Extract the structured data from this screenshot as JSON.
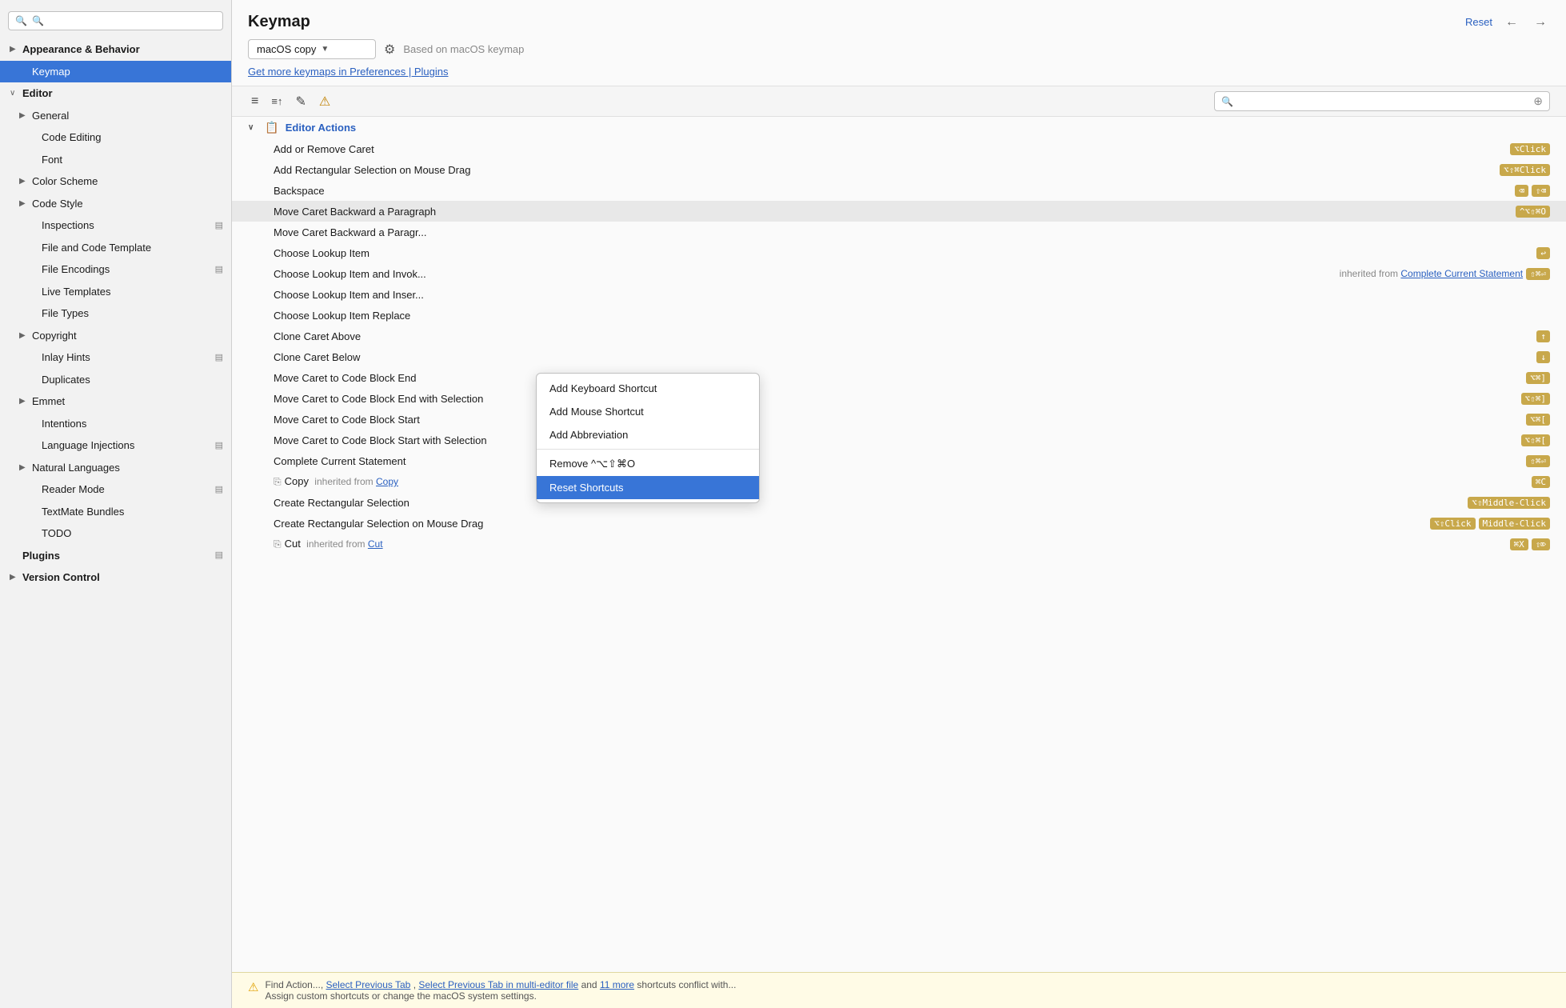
{
  "sidebar": {
    "search_placeholder": "🔍",
    "items": [
      {
        "id": "appearance-behavior",
        "label": "Appearance & Behavior",
        "indent": 0,
        "arrow": "▶",
        "bold": true
      },
      {
        "id": "keymap",
        "label": "Keymap",
        "indent": 1,
        "selected": true
      },
      {
        "id": "editor",
        "label": "Editor",
        "indent": 0,
        "arrow": "∨",
        "bold": true
      },
      {
        "id": "general",
        "label": "General",
        "indent": 1,
        "arrow": "▶"
      },
      {
        "id": "code-editing",
        "label": "Code Editing",
        "indent": 2
      },
      {
        "id": "font",
        "label": "Font",
        "indent": 2
      },
      {
        "id": "color-scheme",
        "label": "Color Scheme",
        "indent": 1,
        "arrow": "▶"
      },
      {
        "id": "code-style",
        "label": "Code Style",
        "indent": 1,
        "arrow": "▶"
      },
      {
        "id": "inspections",
        "label": "Inspections",
        "indent": 2,
        "has_icon": true
      },
      {
        "id": "file-and-code-template",
        "label": "File and Code Template",
        "indent": 2
      },
      {
        "id": "file-encodings",
        "label": "File Encodings",
        "indent": 2,
        "has_icon": true
      },
      {
        "id": "live-templates",
        "label": "Live Templates",
        "indent": 2
      },
      {
        "id": "file-types",
        "label": "File Types",
        "indent": 2
      },
      {
        "id": "copyright",
        "label": "Copyright",
        "indent": 1,
        "arrow": "▶"
      },
      {
        "id": "inlay-hints",
        "label": "Inlay Hints",
        "indent": 2,
        "has_icon": true
      },
      {
        "id": "duplicates",
        "label": "Duplicates",
        "indent": 2
      },
      {
        "id": "emmet",
        "label": "Emmet",
        "indent": 1,
        "arrow": "▶"
      },
      {
        "id": "intentions",
        "label": "Intentions",
        "indent": 2
      },
      {
        "id": "language-injections",
        "label": "Language Injections",
        "indent": 2,
        "has_icon": true
      },
      {
        "id": "natural-languages",
        "label": "Natural Languages",
        "indent": 1,
        "arrow": "▶"
      },
      {
        "id": "reader-mode",
        "label": "Reader Mode",
        "indent": 2,
        "has_icon": true
      },
      {
        "id": "textmate-bundles",
        "label": "TextMate Bundles",
        "indent": 2
      },
      {
        "id": "todo",
        "label": "TODO",
        "indent": 2
      },
      {
        "id": "plugins",
        "label": "Plugins",
        "indent": 0,
        "bold": true,
        "has_icon": true
      },
      {
        "id": "version-control",
        "label": "Version Control",
        "indent": 0,
        "arrow": "▶",
        "bold": true
      }
    ]
  },
  "header": {
    "title": "Keymap",
    "reset_label": "Reset",
    "nav_back_disabled": false,
    "nav_forward_disabled": false
  },
  "keymap_selector": {
    "value": "macOS copy",
    "based_on": "Based on macOS keymap"
  },
  "link_row": {
    "text": "Get more keymaps in Preferences | Plugins"
  },
  "toolbar": {
    "search_placeholder": "🔍",
    "btn1": "≡",
    "btn2": "≡↑",
    "btn3": "✎",
    "btn4": "⚠"
  },
  "actions": {
    "group_label": "Editor Actions",
    "rows": [
      {
        "name": "Add or Remove Caret",
        "shortcuts": [
          {
            "label": "⌥Click",
            "color": "gold"
          }
        ]
      },
      {
        "name": "Add Rectangular Selection on Mouse Drag",
        "shortcuts": [
          {
            "label": "⌥⇧⌘Click",
            "color": "gold"
          }
        ]
      },
      {
        "name": "Backspace",
        "shortcuts": [
          {
            "label": "⌫",
            "color": "gold"
          },
          {
            "label": "⇧⌫",
            "color": "gold"
          }
        ]
      },
      {
        "name": "Move Caret Backward a Paragraph",
        "highlighted": true,
        "shortcuts": [
          {
            "label": "^⌥⇧⌘O",
            "color": "gold"
          }
        ]
      },
      {
        "name": "Move Caret Backward a Paragr...",
        "shortcuts": []
      },
      {
        "name": "Choose Lookup Item",
        "shortcuts": [
          {
            "label": "↩",
            "color": "gold"
          }
        ]
      },
      {
        "name": "Choose Lookup Item and Invok...",
        "shortcuts": [
          {
            "label": "inherited from Complete Current Statement",
            "inherited": true
          },
          {
            "label": "⇧⌘⏎",
            "color": "gold"
          }
        ]
      },
      {
        "name": "Choose Lookup Item and Inser...",
        "shortcuts": []
      },
      {
        "name": "Choose Lookup Item Replace",
        "shortcuts": []
      },
      {
        "name": "Clone Caret Above",
        "shortcuts": [
          {
            "label": "↑",
            "color": "gold"
          }
        ]
      },
      {
        "name": "Clone Caret Below",
        "shortcuts": [
          {
            "label": "↓",
            "color": "gold"
          }
        ]
      },
      {
        "name": "Move Caret to Code Block End",
        "shortcuts": [
          {
            "label": "⌥⌘]",
            "color": "gold"
          }
        ]
      },
      {
        "name": "Move Caret to Code Block End with Selection",
        "shortcuts": [
          {
            "label": "⌥⇧⌘]",
            "color": "gold"
          }
        ]
      },
      {
        "name": "Move Caret to Code Block Start",
        "shortcuts": [
          {
            "label": "⌥⌘[",
            "color": "gold"
          }
        ]
      },
      {
        "name": "Move Caret to Code Block Start with Selection",
        "shortcuts": [
          {
            "label": "⌥⇧⌘[",
            "color": "gold"
          }
        ]
      },
      {
        "name": "Complete Current Statement",
        "shortcuts": [
          {
            "label": "⇧⌘⏎",
            "color": "gold"
          }
        ]
      },
      {
        "name": "Copy",
        "inherited": true,
        "inherited_from": "Copy",
        "shortcuts": [
          {
            "label": "⌘C",
            "color": "gold"
          }
        ]
      },
      {
        "name": "Create Rectangular Selection",
        "shortcuts": [
          {
            "label": "⌥⇧Middle-Click",
            "color": "gold"
          }
        ]
      },
      {
        "name": "Create Rectangular Selection on Mouse Drag",
        "shortcuts": [
          {
            "label": "⌥⇧Click",
            "color": "gold"
          },
          {
            "label": "Middle-Click",
            "color": "gold"
          }
        ]
      },
      {
        "name": "Cut",
        "inherited": true,
        "inherited_from": "Cut",
        "shortcuts": [
          {
            "label": "⌘X",
            "color": "gold"
          },
          {
            "label": "⇧⌦",
            "color": "gold"
          }
        ]
      }
    ]
  },
  "context_menu": {
    "items": [
      {
        "label": "Add Keyboard Shortcut",
        "selected": false
      },
      {
        "label": "Add Mouse Shortcut",
        "selected": false
      },
      {
        "label": "Add Abbreviation",
        "selected": false
      },
      {
        "separator": true
      },
      {
        "label": "Remove ^⌥⇧⌘O",
        "selected": false
      },
      {
        "label": "Reset Shortcuts",
        "selected": true
      }
    ]
  },
  "bottom_bar": {
    "warning_icon": "⚠",
    "text_before": "Find Action...,",
    "link1": "Select Previous Tab",
    "text_middle": ",",
    "link2": "Select Previous Tab in multi-editor file",
    "text_and": "and",
    "link3": "11 more",
    "text_after": "shortcuts conflict with...",
    "text_line2": "Assign custom shortcuts or change the macOS system settings."
  }
}
